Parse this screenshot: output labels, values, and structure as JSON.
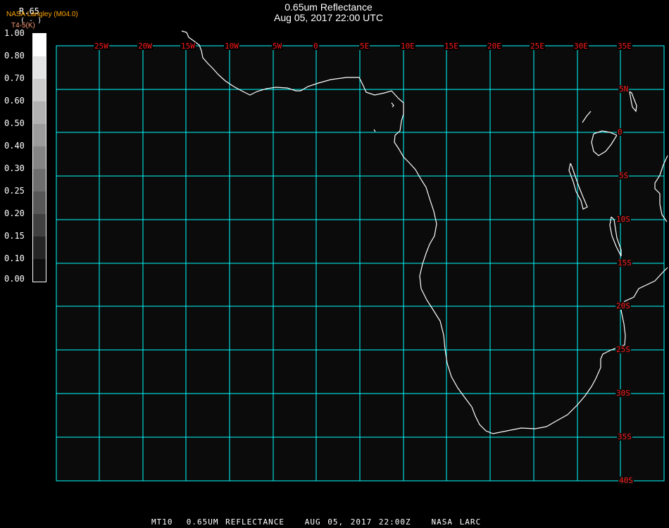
{
  "header": {
    "title": "0.65um Reflectance",
    "subtitle": "Aug 05, 2017 22:00 UTC"
  },
  "legend": {
    "product_label": "R.65",
    "units_label": "( - )",
    "source_label": "NASA Langley (M04.0)",
    "secondary_label": "T4-5(K)",
    "ticks": [
      "1.00",
      "0.80",
      "0.70",
      "0.60",
      "0.50",
      "0.40",
      "0.30",
      "0.25",
      "0.20",
      "0.15",
      "0.10",
      "0.00"
    ],
    "band_colors": [
      "#ffffff",
      "#e4e4e4",
      "#cccccc",
      "#b2b2b2",
      "#9c9c9c",
      "#858585",
      "#6e6e6e",
      "#575757",
      "#404040",
      "#252525",
      "#0e0e0e"
    ]
  },
  "map": {
    "longitude_labels": [
      "25W",
      "20W",
      "15W",
      "10W",
      "5W",
      "0",
      "5E",
      "10E",
      "15E",
      "20E",
      "25E",
      "30E",
      "35E"
    ],
    "latitude_labels": [
      "5N",
      "0",
      "5S",
      "10S",
      "15S",
      "20S",
      "25S",
      "30S",
      "35S",
      "40S"
    ],
    "grid_color": "#00ffff",
    "label_color": "#ff1a1a",
    "coastline_color": "#ffffff",
    "background_color": "#0b0b0b"
  },
  "footer": {
    "text": "MT10  0.65UM REFLECTANCE   AUG 05, 2017 22:00Z   NASA LARC"
  }
}
